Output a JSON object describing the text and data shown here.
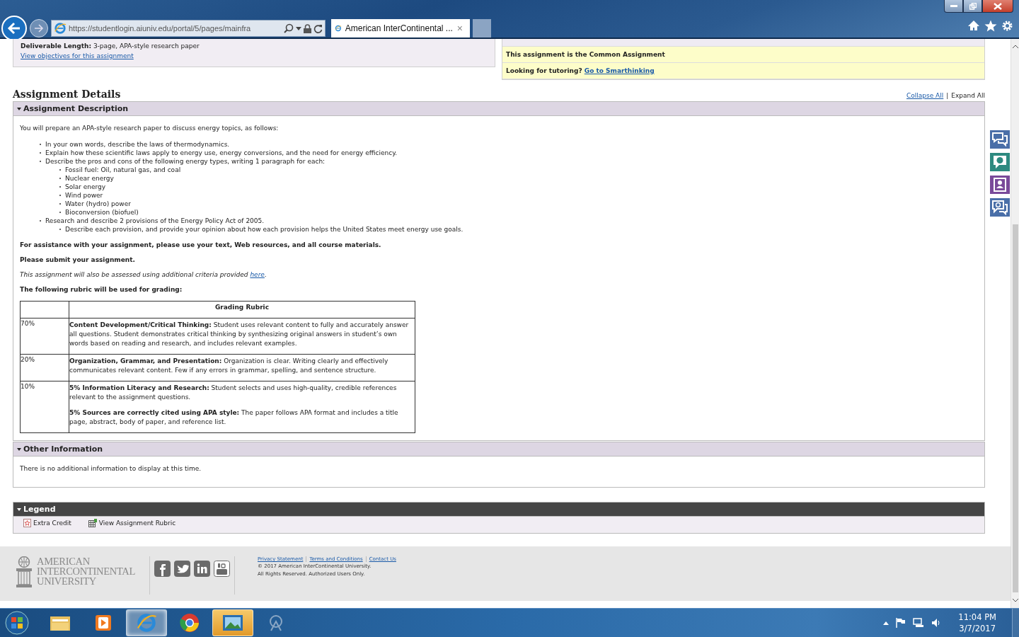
{
  "browser": {
    "url": "https://studentlogin.aiuniv.edu/portal/5/pages/mainfra",
    "tab_title": "American InterContinental ...",
    "tab_close": "×"
  },
  "summary": {
    "deliverable_label": "Deliverable Length:",
    "deliverable_value": "3-page, APA-style research paper",
    "objectives_link": "View objectives for this assignment"
  },
  "notices": [
    {
      "text": "This assignment is the Common Assignment"
    },
    {
      "text": "Looking for tutoring?",
      "link": "Go to Smarthinking"
    }
  ],
  "details": {
    "title": "Assignment Details",
    "collapse_all": "Collapse All",
    "separator": "|",
    "expand_all": "Expand All"
  },
  "description": {
    "heading": "Assignment Description",
    "expanded": true,
    "intro": "You will prepare an APA-style research paper to discuss energy topics, as follows:",
    "bullets": [
      {
        "text": "In your own words, describe the laws of thermodynamics."
      },
      {
        "text": "Explain how these scientific laws apply to energy use, energy conversions, and the need for energy efficiency."
      },
      {
        "text": "Describe the pros and cons of the following energy types, writing 1 paragraph for each:",
        "children": [
          {
            "text": "Fossil fuel: Oil, natural gas, and coal"
          },
          {
            "text": "Nuclear energy"
          },
          {
            "text": "Solar energy"
          },
          {
            "text": "Wind power"
          },
          {
            "text": "Water (hydro) power"
          },
          {
            "text": "Bioconversion (biofuel)"
          }
        ]
      },
      {
        "text": "Research and describe 2 provisions of the Energy Policy Act of 2005.",
        "children": [
          {
            "text": "Describe each provision, and provide your opinion about how each provision helps the United States meet energy use goals."
          }
        ]
      }
    ],
    "assistance": "For assistance with your assignment, please use your text, Web resources, and all course materials.",
    "submit": "Please submit your assignment.",
    "criteria": {
      "text": "This assignment will also be assessed using additional criteria provided ",
      "link": "here",
      "end": "."
    },
    "rubric_intro": "The following rubric will be used for grading:",
    "rubric": {
      "header": "Grading Rubric",
      "rows": [
        {
          "weight": "70%",
          "items": [
            "**Content Development/Critical Thinking:** Student uses relevant content to fully and accurately answer all questions. Student demonstrates critical thinking by synthesizing original answers in student’s own words based on reading and research, and includes relevant examples."
          ]
        },
        {
          "weight": "20%",
          "items": [
            "**Organization, Grammar, and Presentation:** Organization is clear. Writing clearly and effectively communicates relevant content. Few if any errors in grammar, spelling, and sentence structure."
          ]
        },
        {
          "weight": "10%",
          "items": [
            "**5% Information Literacy and Research:** Student selects and uses high-quality, credible references relevant to the assignment questions.",
            "**5% Sources are correctly cited using APA style:** The paper follows APA format and includes a title page, abstract, body of paper, and reference list."
          ]
        }
      ]
    }
  },
  "other": {
    "heading": "Other Information",
    "expanded": true,
    "text": "There is no additional information to display at this time."
  },
  "legend": {
    "heading": "Legend",
    "expanded": true,
    "items": [
      {
        "kind": "extra-credit",
        "label": "Extra Credit"
      },
      {
        "kind": "rubric",
        "label": "View Assignment Rubric"
      }
    ]
  },
  "footer": {
    "logo": [
      "AMERICAN",
      "INTERCONTINENTAL",
      "UNIVERSITY"
    ],
    "links": [
      "Privacy Statement",
      "Terms and Conditions",
      "Contact Us"
    ],
    "copyright": [
      "© 2017 American InterContinental University.",
      "All Rights Reserved. Authorized Users Only."
    ]
  },
  "taskbar": {
    "time": "11:04 PM",
    "date": "3/7/2017",
    "apps": [
      {
        "kind": "folder",
        "selected": false,
        "attention": false
      },
      {
        "kind": "media",
        "selected": false,
        "attention": false
      },
      {
        "kind": "ie",
        "selected": true,
        "attention": false
      },
      {
        "kind": "chrome",
        "selected": false,
        "attention": false
      },
      {
        "kind": "photo",
        "selected": false,
        "attention": true
      },
      {
        "kind": "snip",
        "selected": false,
        "attention": false
      }
    ]
  }
}
